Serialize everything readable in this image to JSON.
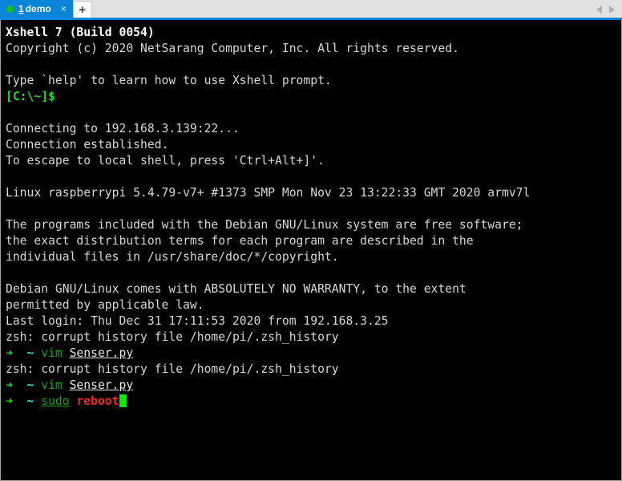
{
  "window": {
    "app_name": "Xshell 7",
    "border_color": "#a0a0a0",
    "chrome_bg": "#e1e1e1"
  },
  "tabbar": {
    "accent_color": "#0a84d8",
    "status_dot_color": "#14c414",
    "tabs": [
      {
        "index_label": "1",
        "title": "demo",
        "close_label": "×",
        "active": true
      }
    ],
    "new_tab_label": "+",
    "nav_prev_icon": "chevron-left-icon",
    "nav_next_icon": "chevron-right-icon"
  },
  "terminal": {
    "background": "#000000",
    "foreground": "#d6d6d6",
    "cursor_color": "#00ef00",
    "lines": [
      {
        "id": "l1",
        "segments": [
          {
            "text": "Xshell 7 (Build 0054)",
            "style": "bold-white"
          }
        ]
      },
      {
        "id": "l2",
        "segments": [
          {
            "text": "Copyright (c) 2020 NetSarang Computer, Inc. All rights reserved.",
            "style": "white"
          }
        ]
      },
      {
        "id": "l3",
        "segments": [
          {
            "text": "",
            "style": "white"
          }
        ]
      },
      {
        "id": "l4",
        "segments": [
          {
            "text": "Type `help' to learn how to use Xshell prompt.",
            "style": "white"
          }
        ]
      },
      {
        "id": "l5",
        "segments": [
          {
            "text": "[C:\\~]$",
            "style": "green"
          }
        ]
      },
      {
        "id": "l6",
        "segments": [
          {
            "text": "",
            "style": "white"
          }
        ]
      },
      {
        "id": "l7",
        "segments": [
          {
            "text": "Connecting to 192.168.3.139:22...",
            "style": "white"
          }
        ]
      },
      {
        "id": "l8",
        "segments": [
          {
            "text": "Connection established.",
            "style": "white"
          }
        ]
      },
      {
        "id": "l9",
        "segments": [
          {
            "text": "To escape to local shell, press 'Ctrl+Alt+]'.",
            "style": "white"
          }
        ]
      },
      {
        "id": "l10",
        "segments": [
          {
            "text": "",
            "style": "white"
          }
        ]
      },
      {
        "id": "l11",
        "segments": [
          {
            "text": "Linux raspberrypi 5.4.79-v7+ #1373 SMP Mon Nov 23 13:22:33 GMT 2020 armv7l",
            "style": "white"
          }
        ]
      },
      {
        "id": "l12",
        "segments": [
          {
            "text": "",
            "style": "white"
          }
        ]
      },
      {
        "id": "l13",
        "segments": [
          {
            "text": "The programs included with the Debian GNU/Linux system are free software;",
            "style": "white"
          }
        ]
      },
      {
        "id": "l14",
        "segments": [
          {
            "text": "the exact distribution terms for each program are described in the",
            "style": "white"
          }
        ]
      },
      {
        "id": "l15",
        "segments": [
          {
            "text": "individual files in /usr/share/doc/*/copyright.",
            "style": "white"
          }
        ]
      },
      {
        "id": "l16",
        "segments": [
          {
            "text": "",
            "style": "white"
          }
        ]
      },
      {
        "id": "l17",
        "segments": [
          {
            "text": "Debian GNU/Linux comes with ABSOLUTELY NO WARRANTY, to the extent",
            "style": "white"
          }
        ]
      },
      {
        "id": "l18",
        "segments": [
          {
            "text": "permitted by applicable law.",
            "style": "white"
          }
        ]
      },
      {
        "id": "l19",
        "segments": [
          {
            "text": "Last login: Thu Dec 31 17:11:53 2020 from 192.168.3.25",
            "style": "white"
          }
        ]
      },
      {
        "id": "l20",
        "segments": [
          {
            "text": "zsh: corrupt history file /home/pi/.zsh_history",
            "style": "white"
          }
        ]
      },
      {
        "id": "l21",
        "segments": [
          {
            "text": "➜",
            "style": "green"
          },
          {
            "text": "  ",
            "style": "white"
          },
          {
            "text": "~",
            "style": "cyan"
          },
          {
            "text": " ",
            "style": "white"
          },
          {
            "text": "vim",
            "style": "dimgreen"
          },
          {
            "text": " ",
            "style": "white"
          },
          {
            "text": "Senser.py",
            "style": "file"
          }
        ]
      },
      {
        "id": "l22",
        "segments": [
          {
            "text": "zsh: corrupt history file /home/pi/.zsh_history",
            "style": "white"
          }
        ]
      },
      {
        "id": "l23",
        "segments": [
          {
            "text": "➜",
            "style": "green"
          },
          {
            "text": "  ",
            "style": "white"
          },
          {
            "text": "~",
            "style": "cyan"
          },
          {
            "text": " ",
            "style": "white"
          },
          {
            "text": "vim",
            "style": "dimgreen"
          },
          {
            "text": " ",
            "style": "white"
          },
          {
            "text": "Senser.py",
            "style": "file"
          }
        ]
      },
      {
        "id": "l24",
        "segments": [
          {
            "text": "➜",
            "style": "green"
          },
          {
            "text": "  ",
            "style": "white"
          },
          {
            "text": "~",
            "style": "cyan"
          },
          {
            "text": " ",
            "style": "white"
          },
          {
            "text": "sudo",
            "style": "dimgreen-u"
          },
          {
            "text": " ",
            "style": "white"
          },
          {
            "text": "reboot",
            "style": "red"
          },
          {
            "text": "",
            "style": "cursor"
          }
        ]
      }
    ]
  }
}
